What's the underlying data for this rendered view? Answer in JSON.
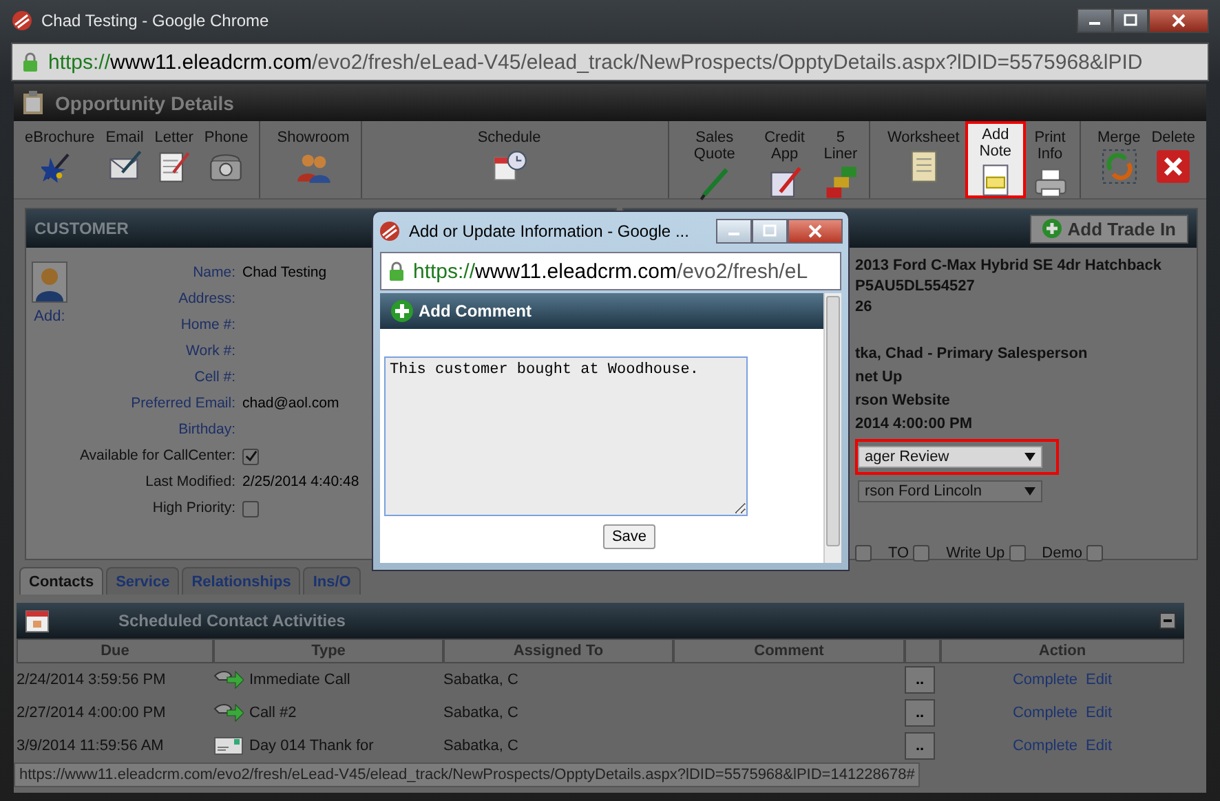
{
  "window": {
    "title": "Chad Testing - Google Chrome",
    "url": {
      "scheme": "https://",
      "host": "www11.eleadcrm.com",
      "path": "/evo2/fresh/eLead-V45/elead_track/NewProspects/OpptyDetails.aspx?lDID=5575968&lPID"
    }
  },
  "page": {
    "title": "Opportunity Details"
  },
  "toolbar": [
    {
      "items": [
        {
          "label": "eBrochure",
          "highlighted": false
        },
        {
          "label": "Email",
          "highlighted": false
        },
        {
          "label": "Letter",
          "highlighted": false
        },
        {
          "label": "Phone",
          "highlighted": false
        }
      ]
    },
    {
      "items": [
        {
          "label": "Showroom",
          "highlighted": false
        }
      ]
    },
    {
      "items": [
        {
          "label": "Schedule",
          "highlighted": false
        }
      ]
    },
    {
      "items": [
        {
          "label": "Sales Quote",
          "highlighted": false
        },
        {
          "label": "Credit App",
          "highlighted": false
        },
        {
          "label": "5 Liner",
          "highlighted": false
        }
      ]
    },
    {
      "items": [
        {
          "label": "Worksheet",
          "highlighted": false
        },
        {
          "label": "Add Note",
          "highlighted": true
        },
        {
          "label": "Print Info",
          "highlighted": false
        }
      ]
    },
    {
      "items": [
        {
          "label": "Merge",
          "highlighted": false
        },
        {
          "label": "Delete",
          "highlighted": false
        }
      ]
    }
  ],
  "customer": {
    "title": "CUSTOMER",
    "photo_label": "Add:",
    "fields": [
      {
        "kind": "field",
        "label": "Name:",
        "value": "Chad Testing"
      },
      {
        "kind": "field",
        "label": "Address:"
      },
      {
        "kind": "field",
        "label": "Home #:"
      },
      {
        "kind": "field",
        "label": "Work #:"
      },
      {
        "kind": "field",
        "label": "Cell #:"
      },
      {
        "kind": "field",
        "label": "Preferred Email:",
        "value": "chad@aol.com"
      },
      {
        "kind": "field",
        "label": "Birthday:"
      },
      {
        "kind": "check",
        "label": "Available for CallCenter:",
        "checked": true
      },
      {
        "kind": "info",
        "label": "Last Modified:",
        "value": "2/25/2014 4:40:48"
      },
      {
        "kind": "check",
        "label": "High Priority:",
        "checked": false
      }
    ]
  },
  "vehicle": {
    "button": "Add Trade In",
    "lines": [
      "2013 Ford C-Max Hybrid SE 4dr Hatchback",
      "P5AU5DL554527",
      "26",
      "tka, Chad  - Primary Salesperson",
      "net Up",
      "rson Website",
      "2014 4:00:00 PM"
    ],
    "dropdowns": [
      {
        "value": "ager Review",
        "highlighted": true
      },
      {
        "value": "rson Ford Lincoln",
        "highlighted": false
      }
    ],
    "checks": [
      {
        "checked": false
      },
      {
        "label": "TO",
        "checked": false
      },
      {
        "label": "Write Up",
        "checked": false
      },
      {
        "label": "Demo",
        "checked": false
      }
    ]
  },
  "tabs": [
    {
      "label": "Contacts",
      "selected": true
    },
    {
      "label": "Service",
      "selected": false
    },
    {
      "label": "Relationships",
      "selected": false
    },
    {
      "label": "Ins/O",
      "selected": false
    }
  ],
  "activities": {
    "title": "Scheduled Contact Activities",
    "columns": [
      "Due",
      "Type",
      "Assigned To",
      "Comment",
      "Action"
    ],
    "rows": [
      {
        "due": "2/24/2014 3:59:56 PM",
        "kind": "call",
        "type": "Immediate Call",
        "assigned": "Sabatka, C",
        "more": "..",
        "actions": [
          "Complete",
          "Edit"
        ]
      },
      {
        "due": "2/27/2014 4:00:00 PM",
        "kind": "call",
        "type": "Call #2",
        "assigned": "Sabatka, C",
        "more": "..",
        "actions": [
          "Complete",
          "Edit"
        ]
      },
      {
        "due": "3/9/2014 11:59:56 AM",
        "kind": "letter",
        "type": "Day 014 Thank for",
        "assigned": "Sabatka, C",
        "more": "..",
        "actions": [
          "Complete",
          "Edit"
        ]
      }
    ]
  },
  "popup": {
    "title": "Add or Update Information - Google ...",
    "url": {
      "scheme": "https://",
      "host": "www11.eleadcrm.com",
      "path": "/evo2/fresh/eL"
    },
    "heading": "Add Comment",
    "comment": "This customer bought at Woodhouse.",
    "button": "Save"
  },
  "status_bar": "https://www11.eleadcrm.com/evo2/fresh/eLead-V45/elead_track/NewProspects/OpptyDetails.aspx?lDID=5575968&lPID=141228678#"
}
